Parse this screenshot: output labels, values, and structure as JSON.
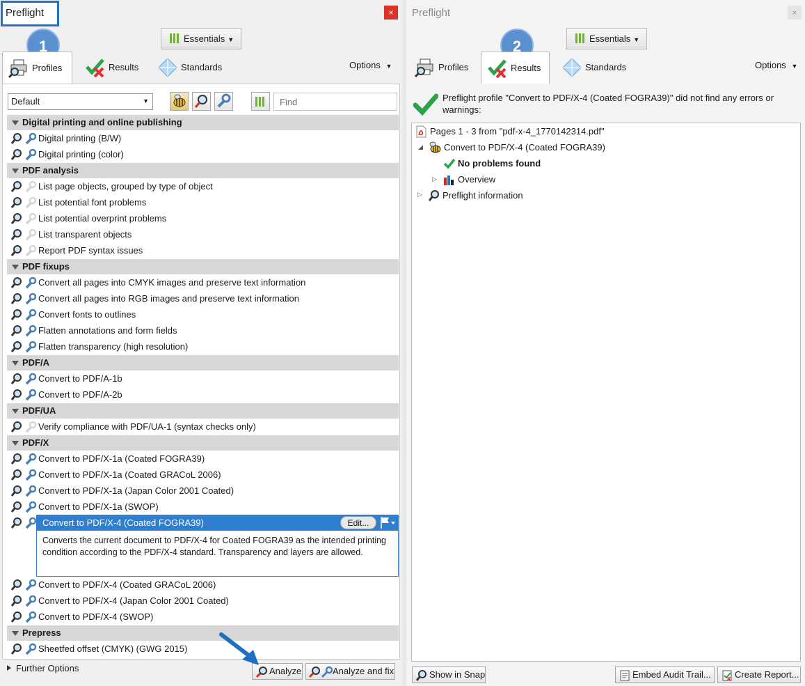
{
  "left": {
    "title": "Preflight",
    "close_glyph": "×",
    "essentials_label": "Essentials",
    "badge_number": "1",
    "tabs": [
      {
        "label": "Profiles",
        "icon": "printer-magnifier-icon",
        "active": true
      },
      {
        "label": "Results",
        "icon": "check-cross-icon",
        "active": false
      },
      {
        "label": "Standards",
        "icon": "diamond-icon",
        "active": false
      }
    ],
    "options_label": "Options",
    "profile_select_value": "Default",
    "find_placeholder": "Find",
    "sections": [
      {
        "title": "Digital printing and online publishing",
        "items": [
          {
            "label": "Digital printing (B/W)",
            "fixup": true
          },
          {
            "label": "Digital printing (color)",
            "fixup": true
          }
        ]
      },
      {
        "title": "PDF analysis",
        "items": [
          {
            "label": "List page objects, grouped by type of object",
            "fixup": false
          },
          {
            "label": "List potential font problems",
            "fixup": false
          },
          {
            "label": "List potential overprint problems",
            "fixup": false
          },
          {
            "label": "List transparent objects",
            "fixup": false
          },
          {
            "label": "Report PDF syntax issues",
            "fixup": false
          }
        ]
      },
      {
        "title": "PDF fixups",
        "items": [
          {
            "label": "Convert all pages into CMYK images and preserve text information",
            "fixup": true
          },
          {
            "label": "Convert all pages into RGB images and preserve text information",
            "fixup": true
          },
          {
            "label": "Convert fonts to outlines",
            "fixup": true
          },
          {
            "label": "Flatten annotations and form fields",
            "fixup": true
          },
          {
            "label": "Flatten transparency (high resolution)",
            "fixup": true
          }
        ]
      },
      {
        "title": "PDF/A",
        "items": [
          {
            "label": "Convert to PDF/A-1b",
            "fixup": true
          },
          {
            "label": "Convert to PDF/A-2b",
            "fixup": true
          }
        ]
      },
      {
        "title": "PDF/UA",
        "items": [
          {
            "label": "Verify compliance with PDF/UA-1 (syntax checks only)",
            "fixup": false
          }
        ]
      },
      {
        "title": "PDF/X",
        "items": [
          {
            "label": "Convert to PDF/X-1a (Coated FOGRA39)",
            "fixup": true
          },
          {
            "label": "Convert to PDF/X-1a (Coated GRACoL 2006)",
            "fixup": true
          },
          {
            "label": "Convert to PDF/X-1a (Japan Color 2001 Coated)",
            "fixup": true
          },
          {
            "label": "Convert to PDF/X-1a (SWOP)",
            "fixup": true
          },
          {
            "label": "Convert to PDF/X-4 (Coated FOGRA39)",
            "fixup": true,
            "selected": true,
            "description": "Converts the current document to PDF/X-4 for Coated FOGRA39 as the intended printing condition according to the PDF/X-4 standard. Transparency and layers are allowed."
          },
          {
            "label": "Convert to PDF/X-4 (Coated GRACoL 2006)",
            "fixup": true
          },
          {
            "label": "Convert to PDF/X-4 (Japan Color 2001 Coated)",
            "fixup": true
          },
          {
            "label": "Convert to PDF/X-4 (SWOP)",
            "fixup": true
          }
        ]
      },
      {
        "title": "Prepress",
        "items": [
          {
            "label": "Sheetfed offset (CMYK) (GWG 2015)",
            "fixup": true
          }
        ]
      }
    ],
    "edit_label": "Edit...",
    "further_options": "Further Options",
    "analyze_label": "Analyze",
    "analyze_fix_label": "Analyze and fix"
  },
  "right": {
    "title": "Preflight",
    "close_glyph": "×",
    "essentials_label": "Essentials",
    "badge_number": "2",
    "tabs": [
      {
        "label": "Profiles"
      },
      {
        "label": "Results"
      },
      {
        "label": "Standards"
      }
    ],
    "options_label": "Options",
    "result_message": "Preflight profile \"Convert to PDF/X-4 (Coated FOGRA39)\" did not find any errors or warnings:",
    "tree": {
      "root": "Pages 1 - 3 from \"pdf-x-4_1770142314.pdf\"",
      "profile": "Convert to PDF/X-4 (Coated FOGRA39)",
      "no_problems": "No problems found",
      "overview": "Overview",
      "preflight_info": "Preflight information"
    },
    "show_in_snap": "Show in Snap",
    "embed_audit": "Embed Audit Trail...",
    "create_report": "Create Report..."
  },
  "colors": {
    "accent_blue": "#2f7fd0",
    "badge_blue": "#5a8fd0",
    "check_green": "#2aa34a",
    "close_red": "#d9342b"
  }
}
